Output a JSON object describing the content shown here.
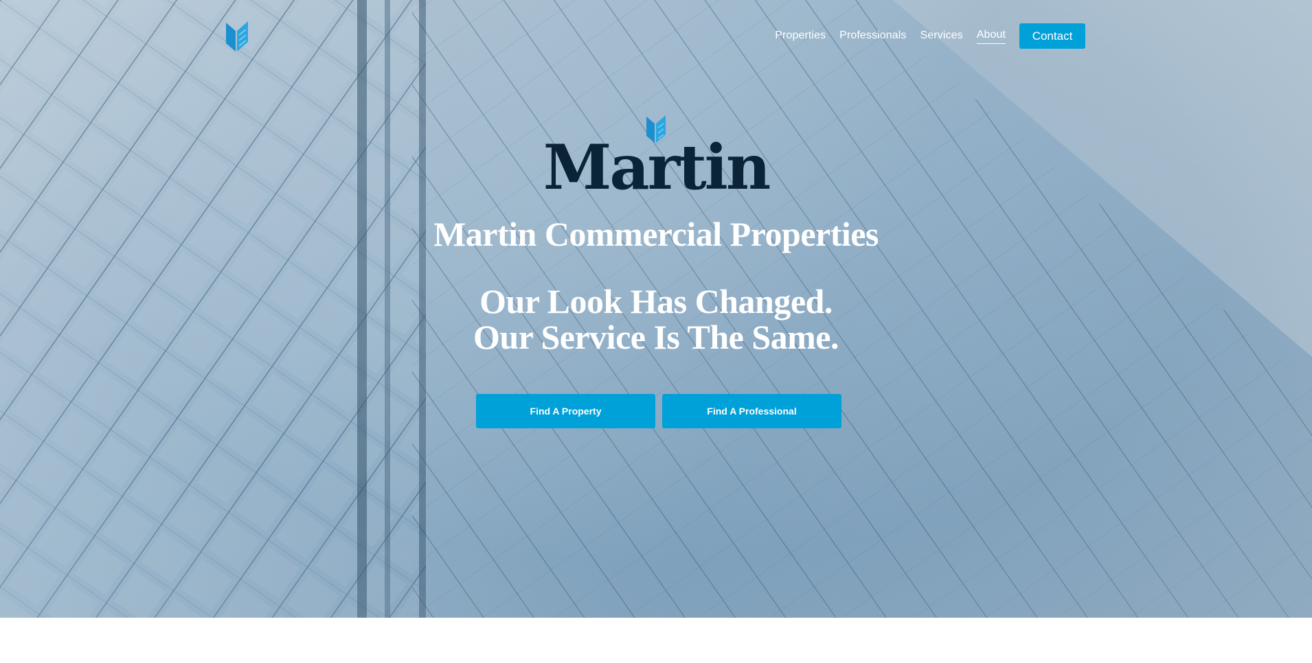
{
  "brand": {
    "logo_icon": "martin-chevron-logo-icon",
    "wordmark": "Martin",
    "accent_color": "#00a0d8",
    "wordmark_color": "#0a2336"
  },
  "nav": {
    "items": [
      {
        "label": "Properties"
      },
      {
        "label": "Professionals"
      },
      {
        "label": "Services"
      },
      {
        "label": "About"
      }
    ],
    "active": "About",
    "contact_label": "Contact"
  },
  "hero": {
    "company_name": "Martin Commercial Properties",
    "tagline_line1": "Our Look Has Changed.",
    "tagline_line2": "Our Service Is The Same.",
    "buttons": {
      "find_property": "Find A Property",
      "find_professional": "Find A Professional"
    }
  }
}
